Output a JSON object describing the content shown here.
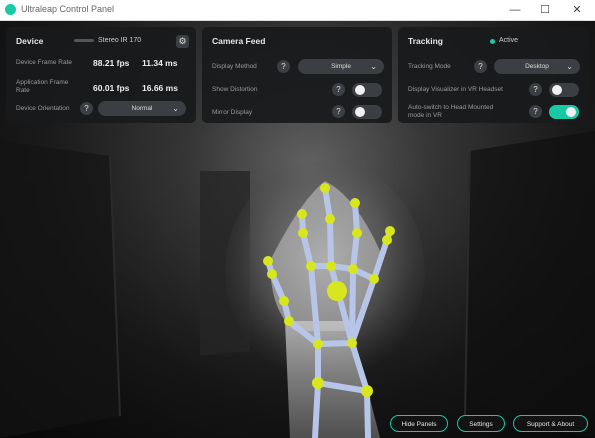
{
  "window": {
    "title": "Ultraleap Control Panel",
    "minimize": "—",
    "maximize": "☐",
    "close": "✕"
  },
  "device_panel": {
    "title": "Device",
    "device_name": "Stereo IR 170",
    "frame_rate_label": "Device Frame Rate",
    "frame_rate_fps": "88.21 fps",
    "frame_rate_ms": "11.34 ms",
    "app_frame_rate_label_1": "Application Frame",
    "app_frame_rate_label_2": "Rate",
    "app_frame_rate_fps": "60.01 fps",
    "app_frame_rate_ms": "16.66 ms",
    "orientation_label": "Device Orientation",
    "orientation_value": "Normal"
  },
  "camera_panel": {
    "title": "Camera Feed",
    "display_method_label": "Display Method",
    "display_method_value": "Simple",
    "show_distortion_label": "Show Distortion",
    "show_distortion_on": false,
    "mirror_display_label": "Mirror Display",
    "mirror_display_on": false
  },
  "tracking_panel": {
    "title": "Tracking",
    "status": "Active",
    "mode_label": "Tracking Mode",
    "mode_value": "Desktop",
    "vr_visualize_label": "Display Visualizer in VR Headset",
    "vr_visualize_on": false,
    "auto_switch_label_1": "Auto-switch to Head Mounted",
    "auto_switch_label_2": "mode in VR",
    "auto_switch_on": true
  },
  "help_glyph": "?",
  "chevron_glyph": "⌄",
  "gear_glyph": "⚙",
  "bottom_buttons": {
    "hide_panels": "Hide Panels",
    "settings": "Settings",
    "support": "Support & About"
  },
  "colors": {
    "accent": "#19c9a6",
    "joint": "#d7e61e",
    "bone": "#b7c6e8",
    "panel": "#181a1c"
  }
}
